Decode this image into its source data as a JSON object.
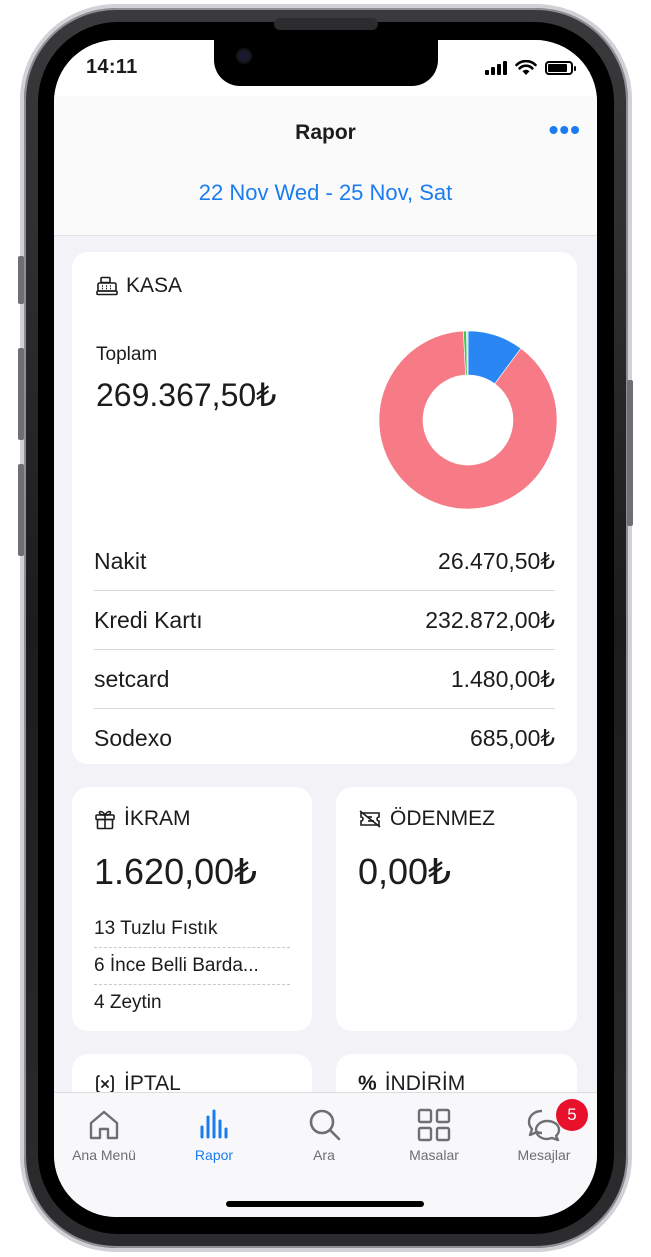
{
  "status_bar": {
    "time": "14:11"
  },
  "header": {
    "title": "Rapor",
    "more_label": "•••",
    "date_range": "22 Nov Wed - 25 Nov, Sat"
  },
  "kasa": {
    "title": "KASA",
    "total_label": "Toplam",
    "total_value": "269.367,50₺",
    "rows": [
      {
        "label": "Nakit",
        "value": "26.470,50₺"
      },
      {
        "label": "Kredi Kartı",
        "value": "232.872,00₺"
      },
      {
        "label": "setcard",
        "value": "1.480,00₺"
      },
      {
        "label": "Sodexo",
        "value": "685,00₺"
      }
    ],
    "donut": [
      {
        "name": "Nakit",
        "value": 26470.5,
        "color": "#2a86f3"
      },
      {
        "name": "Kredi Kartı",
        "value": 232872.0,
        "color": "#f67b87"
      },
      {
        "name": "setcard",
        "value": 1480.0,
        "color": "#3ec45a"
      },
      {
        "name": "Sodexo",
        "value": 685.0,
        "color": "#d9d9d9"
      }
    ]
  },
  "ikram": {
    "title": "İKRAM",
    "value": "1.620,00₺",
    "items": [
      "13 Tuzlu Fıstık",
      "6 İnce Belli Barda...",
      "4 Zeytin"
    ]
  },
  "odenmez": {
    "title": "ÖDENMEZ",
    "value": "0,00₺"
  },
  "iptal": {
    "title": "İPTAL"
  },
  "indirim": {
    "title": "İNDİRİM"
  },
  "tabbar": {
    "tabs": [
      {
        "label": "Ana Menü",
        "icon": "home-icon"
      },
      {
        "label": "Rapor",
        "icon": "chart-bars-icon",
        "active": true
      },
      {
        "label": "Ara",
        "icon": "search-icon"
      },
      {
        "label": "Masalar",
        "icon": "grid-icon"
      },
      {
        "label": "Mesajlar",
        "icon": "chat-bubbles-icon"
      }
    ],
    "messages_badge": "5"
  },
  "colors": {
    "accent": "#1a7cf0",
    "badge": "#e8102a"
  }
}
